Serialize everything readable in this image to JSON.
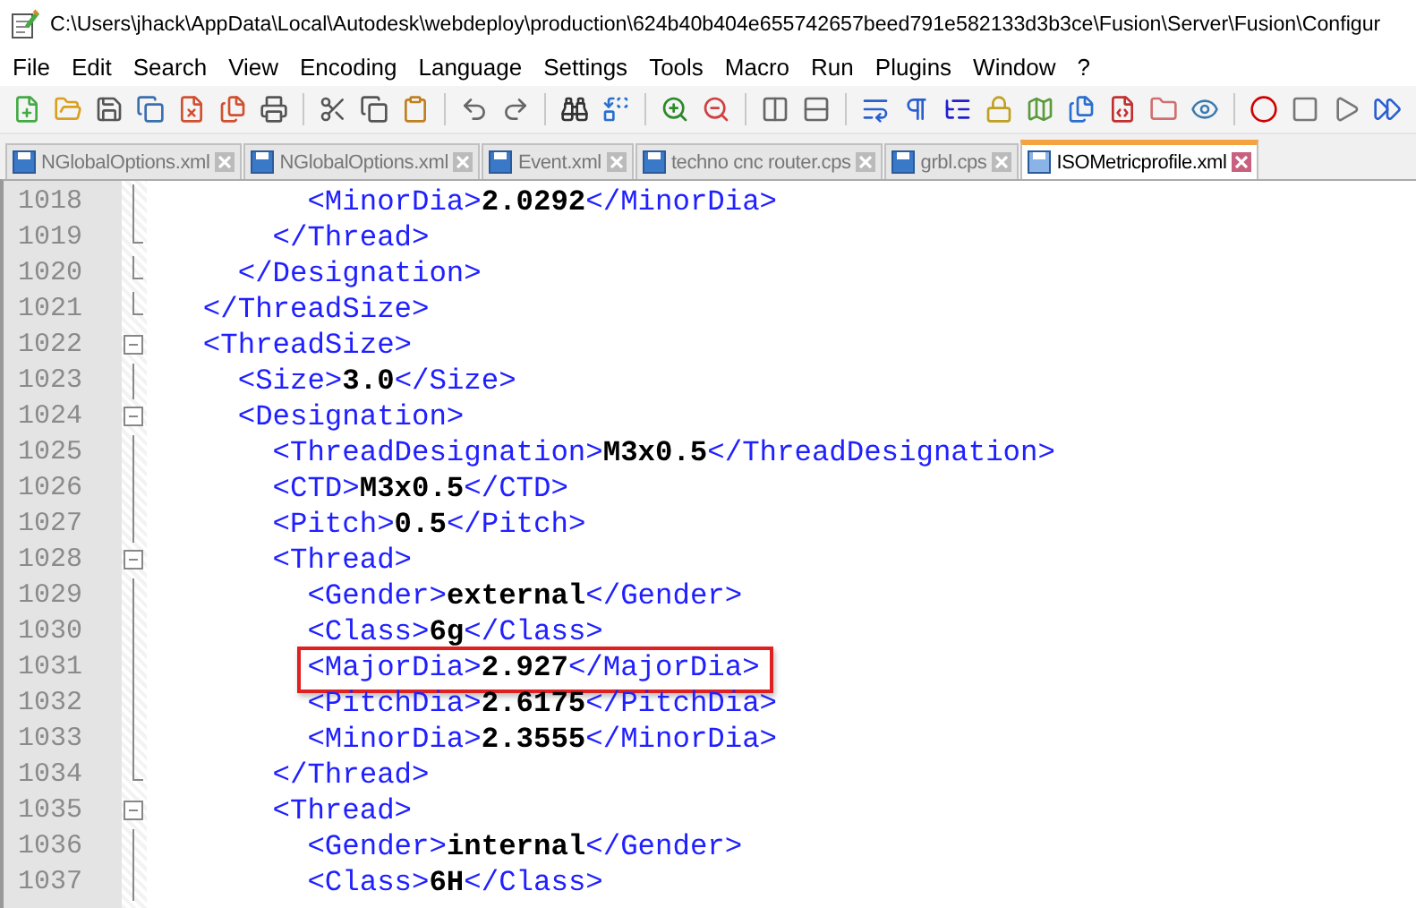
{
  "window": {
    "title": "C:\\Users\\jhack\\AppData\\Local\\Autodesk\\webdeploy\\production\\624b40b404e655742657beed791e582133d3b3ce\\Fusion\\Server\\Fusion\\Configur"
  },
  "menu": [
    "File",
    "Edit",
    "Search",
    "View",
    "Encoding",
    "Language",
    "Settings",
    "Tools",
    "Macro",
    "Run",
    "Plugins",
    "Window",
    "?"
  ],
  "tabs": [
    {
      "label": "NGlobalOptions.xml",
      "selected": false
    },
    {
      "label": "NGlobalOptions.xml",
      "selected": false
    },
    {
      "label": "Event.xml",
      "selected": false
    },
    {
      "label": "techno cnc router.cps",
      "selected": false
    },
    {
      "label": "grbl.cps",
      "selected": false
    },
    {
      "label": "ISOMetricprofile.xml",
      "selected": true
    }
  ],
  "editor": {
    "lines": [
      {
        "number": "1018",
        "kind": "line",
        "highlighted": false,
        "segments": [
          {
            "kind": "tag",
            "text": "        <MinorDia>"
          },
          {
            "kind": "value",
            "text": "2.0292"
          },
          {
            "kind": "tag",
            "text": "</MinorDia>"
          }
        ]
      },
      {
        "number": "1019",
        "kind": "end",
        "highlighted": false,
        "segments": [
          {
            "kind": "tag",
            "text": "      </Thread>"
          }
        ]
      },
      {
        "number": "1020",
        "kind": "end",
        "highlighted": false,
        "segments": [
          {
            "kind": "tag",
            "text": "    </Designation>"
          }
        ]
      },
      {
        "number": "1021",
        "kind": "end",
        "highlighted": false,
        "segments": [
          {
            "kind": "tag",
            "text": "  </ThreadSize>"
          }
        ]
      },
      {
        "number": "1022",
        "kind": "open",
        "highlighted": false,
        "segments": [
          {
            "kind": "tag",
            "text": "  <ThreadSize>"
          }
        ]
      },
      {
        "number": "1023",
        "kind": "line",
        "highlighted": false,
        "segments": [
          {
            "kind": "tag",
            "text": "    <Size>"
          },
          {
            "kind": "value",
            "text": "3.0"
          },
          {
            "kind": "tag",
            "text": "</Size>"
          }
        ]
      },
      {
        "number": "1024",
        "kind": "open",
        "highlighted": false,
        "segments": [
          {
            "kind": "tag",
            "text": "    <Designation>"
          }
        ]
      },
      {
        "number": "1025",
        "kind": "line",
        "highlighted": false,
        "segments": [
          {
            "kind": "tag",
            "text": "      <ThreadDesignation>"
          },
          {
            "kind": "value",
            "text": "M3x0.5"
          },
          {
            "kind": "tag",
            "text": "</ThreadDesignation>"
          }
        ]
      },
      {
        "number": "1026",
        "kind": "line",
        "highlighted": false,
        "segments": [
          {
            "kind": "tag",
            "text": "      <CTD>"
          },
          {
            "kind": "value",
            "text": "M3x0.5"
          },
          {
            "kind": "tag",
            "text": "</CTD>"
          }
        ]
      },
      {
        "number": "1027",
        "kind": "line",
        "highlighted": false,
        "segments": [
          {
            "kind": "tag",
            "text": "      <Pitch>"
          },
          {
            "kind": "value",
            "text": "0.5"
          },
          {
            "kind": "tag",
            "text": "</Pitch>"
          }
        ]
      },
      {
        "number": "1028",
        "kind": "open",
        "highlighted": false,
        "segments": [
          {
            "kind": "tag",
            "text": "      <Thread>"
          }
        ]
      },
      {
        "number": "1029",
        "kind": "line",
        "highlighted": false,
        "segments": [
          {
            "kind": "tag",
            "text": "        <Gender>"
          },
          {
            "kind": "value",
            "text": "external"
          },
          {
            "kind": "tag",
            "text": "</Gender>"
          }
        ]
      },
      {
        "number": "1030",
        "kind": "line",
        "highlighted": false,
        "segments": [
          {
            "kind": "tag",
            "text": "        <Class>"
          },
          {
            "kind": "value",
            "text": "6g"
          },
          {
            "kind": "tag",
            "text": "</Class>"
          }
        ]
      },
      {
        "number": "1031",
        "kind": "line",
        "highlighted": true,
        "segments": [
          {
            "kind": "tag",
            "text": "        <MajorDia>"
          },
          {
            "kind": "value",
            "text": "2.927"
          },
          {
            "kind": "tag",
            "text": "</MajorDia>"
          }
        ]
      },
      {
        "number": "1032",
        "kind": "line",
        "highlighted": false,
        "segments": [
          {
            "kind": "tag",
            "text": "        <PitchDia>"
          },
          {
            "kind": "value",
            "text": "2.6175"
          },
          {
            "kind": "tag",
            "text": "</PitchDia>"
          }
        ]
      },
      {
        "number": "1033",
        "kind": "line",
        "highlighted": false,
        "segments": [
          {
            "kind": "tag",
            "text": "        <MinorDia>"
          },
          {
            "kind": "value",
            "text": "2.3555"
          },
          {
            "kind": "tag",
            "text": "</MinorDia>"
          }
        ]
      },
      {
        "number": "1034",
        "kind": "end",
        "highlighted": false,
        "segments": [
          {
            "kind": "tag",
            "text": "      </Thread>"
          }
        ]
      },
      {
        "number": "1035",
        "kind": "open",
        "highlighted": false,
        "segments": [
          {
            "kind": "tag",
            "text": "      <Thread>"
          }
        ]
      },
      {
        "number": "1036",
        "kind": "line",
        "highlighted": false,
        "segments": [
          {
            "kind": "tag",
            "text": "        <Gender>"
          },
          {
            "kind": "value",
            "text": "internal"
          },
          {
            "kind": "tag",
            "text": "</Gender>"
          }
        ]
      },
      {
        "number": "1037",
        "kind": "line",
        "highlighted": false,
        "segments": [
          {
            "kind": "tag",
            "text": "        <Class>"
          },
          {
            "kind": "value",
            "text": "6H"
          },
          {
            "kind": "tag",
            "text": "</Class>"
          }
        ]
      }
    ]
  }
}
